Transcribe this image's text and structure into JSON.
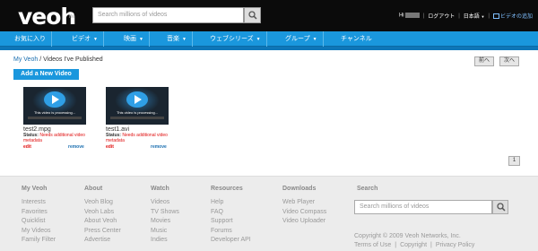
{
  "header": {
    "logo": "veoh",
    "tm": "TM",
    "search_placeholder": "Search millions of videos",
    "greeting": "Hi",
    "logout": "ログアウト",
    "language": "日本語",
    "language_arrow": "▼",
    "add_video": "ビデオの追加"
  },
  "nav": [
    {
      "label": "お気に入り",
      "arrow": ""
    },
    {
      "label": "ビデオ",
      "arrow": "▼"
    },
    {
      "label": "映画",
      "arrow": "▼"
    },
    {
      "label": "音楽",
      "arrow": "▼"
    },
    {
      "label": "ウェブシリーズ",
      "arrow": "▼"
    },
    {
      "label": "グループ",
      "arrow": "▼"
    },
    {
      "label": "チャンネル",
      "arrow": ""
    }
  ],
  "breadcrumb": {
    "root": "My Veoh",
    "sep": "/",
    "current": "Videos I've Published"
  },
  "pager": {
    "prev": "前へ",
    "next": "次へ",
    "page": "1"
  },
  "add_video_button": "Add a New Video",
  "videos": [
    {
      "title": "test2.mpg",
      "status_label": "Status:",
      "status": "Needs additional video metadata",
      "processing": "This video is processing...",
      "edit": "edit",
      "remove": "remove"
    },
    {
      "title": "test1.avi",
      "status_label": "Status:",
      "status": "Needs additional video metadata",
      "processing": "This video is processing...",
      "edit": "edit",
      "remove": "remove"
    }
  ],
  "footer": {
    "columns": [
      {
        "head": "My Veoh",
        "links": [
          "Interests",
          "Favorites",
          "Quicklist",
          "My Videos",
          "Family Filter"
        ]
      },
      {
        "head": "About",
        "links": [
          "Veoh Blog",
          "Veoh Labs",
          "About Veoh",
          "Press Center",
          "Advertise"
        ]
      },
      {
        "head": "Watch",
        "links": [
          "Videos",
          "TV Shows",
          "Movies",
          "Music",
          "Indies"
        ]
      },
      {
        "head": "Resources",
        "links": [
          "Help",
          "FAQ",
          "Support",
          "Forums",
          "Developer API"
        ]
      },
      {
        "head": "Downloads",
        "links": [
          "Web Player",
          "Video Compass",
          "Video Uploader"
        ]
      }
    ],
    "search_head": "Search",
    "search_placeholder": "Search millions of videos",
    "copyright": "Copyright © 2009 Veoh Networks, Inc.",
    "terms": "Terms of Use",
    "copyright_link": "Copyright",
    "privacy": "Privacy Policy",
    "sep": "|"
  }
}
